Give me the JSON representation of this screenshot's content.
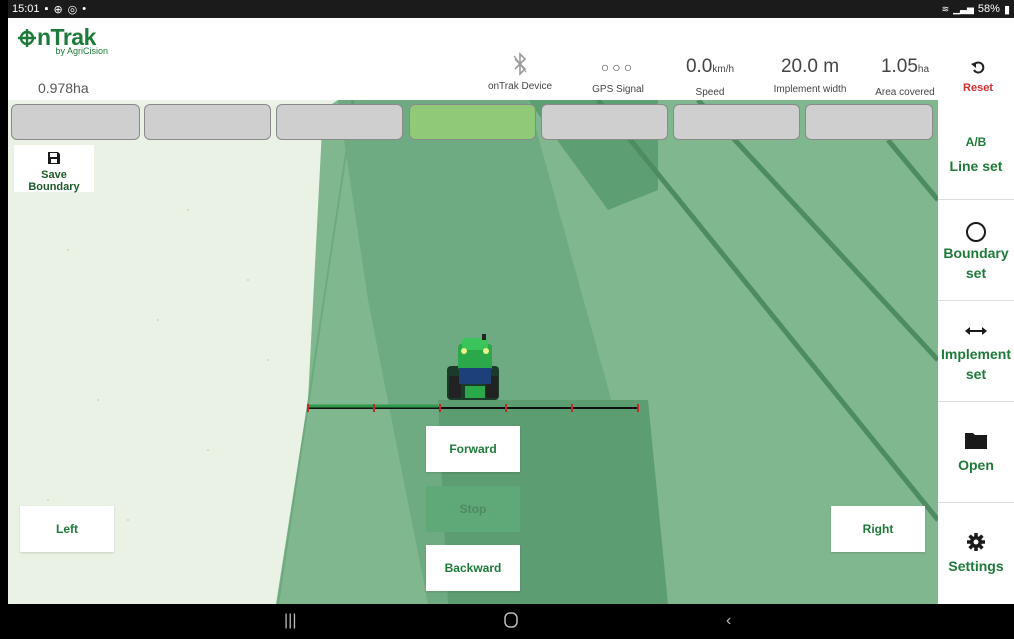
{
  "status_bar": {
    "time": "15:01",
    "battery": "58%"
  },
  "header": {
    "logo_main": "nTrak",
    "logo_sub": "by AgriCision",
    "area": "0.978ha",
    "device": {
      "label": "onTrak Device"
    },
    "gps": {
      "value": "○○○",
      "label": "GPS Signal"
    },
    "speed": {
      "value": "0.0",
      "unit": "km/h",
      "label": "Speed"
    },
    "implement_width": {
      "value": "20.0 m",
      "label": "Implement width"
    },
    "area_covered": {
      "value": "1.05",
      "unit": "ha",
      "label": "Area covered"
    },
    "reset_label": "Reset"
  },
  "sections": [
    {
      "active": false
    },
    {
      "active": false
    },
    {
      "active": false
    },
    {
      "active": true
    },
    {
      "active": false
    },
    {
      "active": false
    },
    {
      "active": false
    }
  ],
  "map": {
    "save_boundary_label": "Save Boundary",
    "forward_label": "Forward",
    "stop_label": "Stop",
    "backward_label": "Backward",
    "left_label": "Left",
    "right_label": "Right"
  },
  "sidebar": {
    "ab_title": "A/B",
    "ab_sub": "Line set",
    "boundary_title": "Boundary",
    "boundary_sub": "set",
    "implement_title": "Implement",
    "implement_sub": "set",
    "open_label": "Open",
    "settings_label": "Settings"
  },
  "colors": {
    "brand_green": "#1e7a3a",
    "reset_red": "#d32f2f",
    "active_section": "#90c978"
  }
}
